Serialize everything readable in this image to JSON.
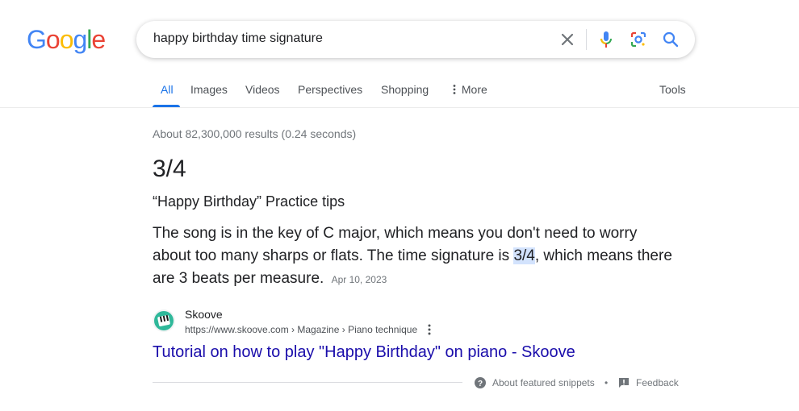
{
  "logo": {
    "letters": [
      "G",
      "o",
      "o",
      "g",
      "l",
      "e"
    ],
    "colors": [
      "#4285F4",
      "#EA4335",
      "#FBBC05",
      "#4285F4",
      "#34A853",
      "#EA4335"
    ]
  },
  "search": {
    "query": "happy birthday time signature"
  },
  "tabs": [
    {
      "label": "All",
      "active": true
    },
    {
      "label": "Images"
    },
    {
      "label": "Videos"
    },
    {
      "label": "Perspectives"
    },
    {
      "label": "Shopping"
    },
    {
      "label": "More"
    }
  ],
  "tools_label": "Tools",
  "stats": "About 82,300,000 results (0.24 seconds)",
  "featured": {
    "answer": "3/4",
    "subheading": "“Happy Birthday” Practice tips",
    "snippet_before": "The song is in the key of C major, which means you don't need to worry about too many sharps or flats. The time signature is ",
    "snippet_highlight": "3/4",
    "snippet_after": ", which means there are 3 beats per measure.",
    "date": "Apr 10, 2023"
  },
  "source": {
    "name": "Skoove",
    "url": "https://www.skoove.com › Magazine › Piano technique",
    "title": "Tutorial on how to play \"Happy Birthday\" on piano - Skoove"
  },
  "footer": {
    "about": "About featured snippets",
    "separator": "•",
    "feedback": "Feedback"
  },
  "colors": {
    "accent": "#1a73e8",
    "link": "#1a0dab",
    "highlight": "#d3e3fd"
  }
}
